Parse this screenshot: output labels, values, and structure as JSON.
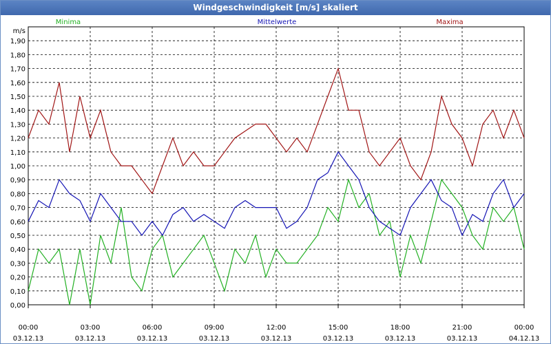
{
  "window": {
    "title": "Windgeschwindigkeit [m/s] skaliert"
  },
  "chart_data": {
    "type": "line",
    "title": "Windgeschwindigkeit [m/s] skaliert",
    "ylabel": "m/s",
    "ylim": [
      0,
      2.0
    ],
    "yticks": [
      "0,00",
      "0,10",
      "0,20",
      "0,30",
      "0,40",
      "0,50",
      "0,60",
      "0,70",
      "0,80",
      "0,90",
      "1,00",
      "1,10",
      "1,20",
      "1,30",
      "1,40",
      "1,50",
      "1,60",
      "1,70",
      "1,80",
      "1,90"
    ],
    "xlim": [
      0,
      24
    ],
    "xticks": [
      {
        "time": "00:00",
        "date": "03.12.13"
      },
      {
        "time": "03:00",
        "date": "03.12.13"
      },
      {
        "time": "06:00",
        "date": "03.12.13"
      },
      {
        "time": "09:00",
        "date": "03.12.13"
      },
      {
        "time": "12:00",
        "date": "03.12.13"
      },
      {
        "time": "15:00",
        "date": "03.12.13"
      },
      {
        "time": "18:00",
        "date": "03.12.13"
      },
      {
        "time": "21:00",
        "date": "03.12.13"
      },
      {
        "time": "00:00",
        "date": "04.12.13"
      }
    ],
    "grid": true,
    "legend_position": "top",
    "x_hours": [
      0,
      0.5,
      1,
      1.5,
      2,
      2.5,
      3,
      3.5,
      4,
      4.5,
      5,
      5.5,
      6,
      6.5,
      7,
      7.5,
      8,
      8.5,
      9,
      9.5,
      10,
      10.5,
      11,
      11.5,
      12,
      12.5,
      13,
      13.5,
      14,
      14.5,
      15,
      15.5,
      16,
      16.5,
      17,
      17.5,
      18,
      18.5,
      19,
      19.5,
      20,
      20.5,
      21,
      21.5,
      22,
      22.5,
      23,
      23.5,
      24
    ],
    "series": [
      {
        "name": "Minima",
        "color": "#22b022",
        "values": [
          0.1,
          0.4,
          0.3,
          0.4,
          0.0,
          0.4,
          0.0,
          0.5,
          0.3,
          0.7,
          0.2,
          0.1,
          0.4,
          0.5,
          0.2,
          0.3,
          0.4,
          0.5,
          0.3,
          0.1,
          0.4,
          0.3,
          0.5,
          0.2,
          0.4,
          0.3,
          0.3,
          0.4,
          0.5,
          0.7,
          0.6,
          0.9,
          0.7,
          0.8,
          0.5,
          0.6,
          0.2,
          0.5,
          0.3,
          0.6,
          0.9,
          0.8,
          0.7,
          0.5,
          0.4,
          0.7,
          0.6,
          0.7,
          0.4
        ]
      },
      {
        "name": "Mittelwerte",
        "color": "#1414b4",
        "values": [
          0.6,
          0.75,
          0.7,
          0.9,
          0.8,
          0.75,
          0.6,
          0.8,
          0.7,
          0.6,
          0.6,
          0.5,
          0.6,
          0.5,
          0.65,
          0.7,
          0.6,
          0.65,
          0.6,
          0.55,
          0.7,
          0.75,
          0.7,
          0.7,
          0.7,
          0.55,
          0.6,
          0.7,
          0.9,
          0.95,
          1.1,
          1.0,
          0.9,
          0.7,
          0.6,
          0.55,
          0.5,
          0.7,
          0.8,
          0.9,
          0.75,
          0.7,
          0.5,
          0.65,
          0.6,
          0.8,
          0.9,
          0.7,
          0.8
        ]
      },
      {
        "name": "Maxima",
        "color": "#a01414",
        "values": [
          1.2,
          1.4,
          1.3,
          1.6,
          1.1,
          1.5,
          1.2,
          1.4,
          1.1,
          1.0,
          1.0,
          0.9,
          0.8,
          1.0,
          1.2,
          1.0,
          1.1,
          1.0,
          1.0,
          1.1,
          1.2,
          1.25,
          1.3,
          1.3,
          1.2,
          1.1,
          1.2,
          1.1,
          1.3,
          1.5,
          1.7,
          1.4,
          1.4,
          1.1,
          1.0,
          1.1,
          1.2,
          1.0,
          0.9,
          1.1,
          1.5,
          1.3,
          1.2,
          1.0,
          1.3,
          1.4,
          1.2,
          1.4,
          1.2
        ]
      }
    ]
  }
}
